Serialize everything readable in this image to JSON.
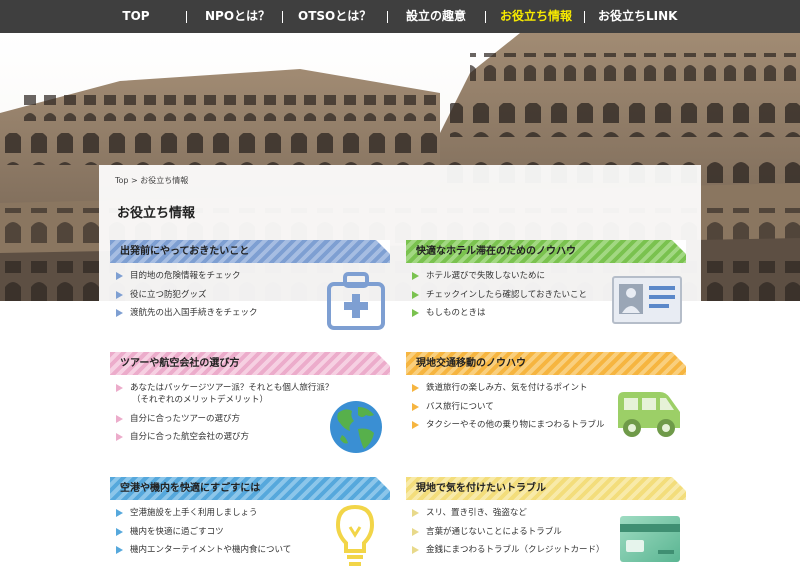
{
  "nav": {
    "items": [
      {
        "label": "TOP",
        "active": false
      },
      {
        "label": "NPOとは？",
        "active": false
      },
      {
        "label": "OTSOとは？",
        "active": false
      },
      {
        "label": "設立の趣意",
        "active": false
      },
      {
        "label": "お役立ち情報",
        "active": true
      },
      {
        "label": "お役立ちLINK",
        "active": false
      }
    ]
  },
  "breadcrumb": "Top > お役立ち情報",
  "page_title": "お役立ち情報",
  "colors": {
    "nav_bg": "#3f3f3f",
    "nav_active": "#f7ea00",
    "blue": "#7e9fd2",
    "green": "#7ac24f",
    "pink": "#ecaccb",
    "orange": "#f6b540",
    "sky": "#56a8dc",
    "yellow": "#f3dd7b"
  },
  "sections": [
    {
      "title": "出発前にやっておきたいこと",
      "icon": "first-aid-kit-icon",
      "items": [
        "目的地の危険情報をチェック",
        "役に立つ防犯グッズ",
        "渡航先の出入国手続きをチェック"
      ]
    },
    {
      "title": "快適なホテル滞在のためのノウハウ",
      "icon": "id-card-icon",
      "items": [
        "ホテル選びで失敗しないために",
        "チェックインしたら確認しておきたいこと",
        "もしものときは"
      ]
    },
    {
      "title": "ツアーや航空会社の選び方",
      "icon": "globe-icon",
      "items": [
        "あなたはパッケージツアー派？それとも個人旅行派？",
        "（それぞれのメリットデメリット）",
        "自分に合ったツアーの選び方",
        "自分に合った航空会社の選び方"
      ]
    },
    {
      "title": "現地交通移動のノウハウ",
      "icon": "van-icon",
      "items": [
        "鉄道旅行の楽しみ方、気を付けるポイント",
        "バス旅行について",
        "タクシーやその他の乗り物にまつわるトラブル"
      ]
    },
    {
      "title": "空港や機内を快適にすごすには",
      "icon": "light-bulb-icon",
      "items": [
        "空港施設を上手く利用しましょう",
        "機内を快適に過ごすコツ",
        "機内エンターテイメントや機内食について"
      ]
    },
    {
      "title": "現地で気を付けたいトラブル",
      "icon": "credit-card-icon",
      "items": [
        "スリ、置き引き、強盗など",
        "言葉が通じないことによるトラブル",
        "金銭にまつわるトラブル（クレジットカード）"
      ]
    }
  ]
}
